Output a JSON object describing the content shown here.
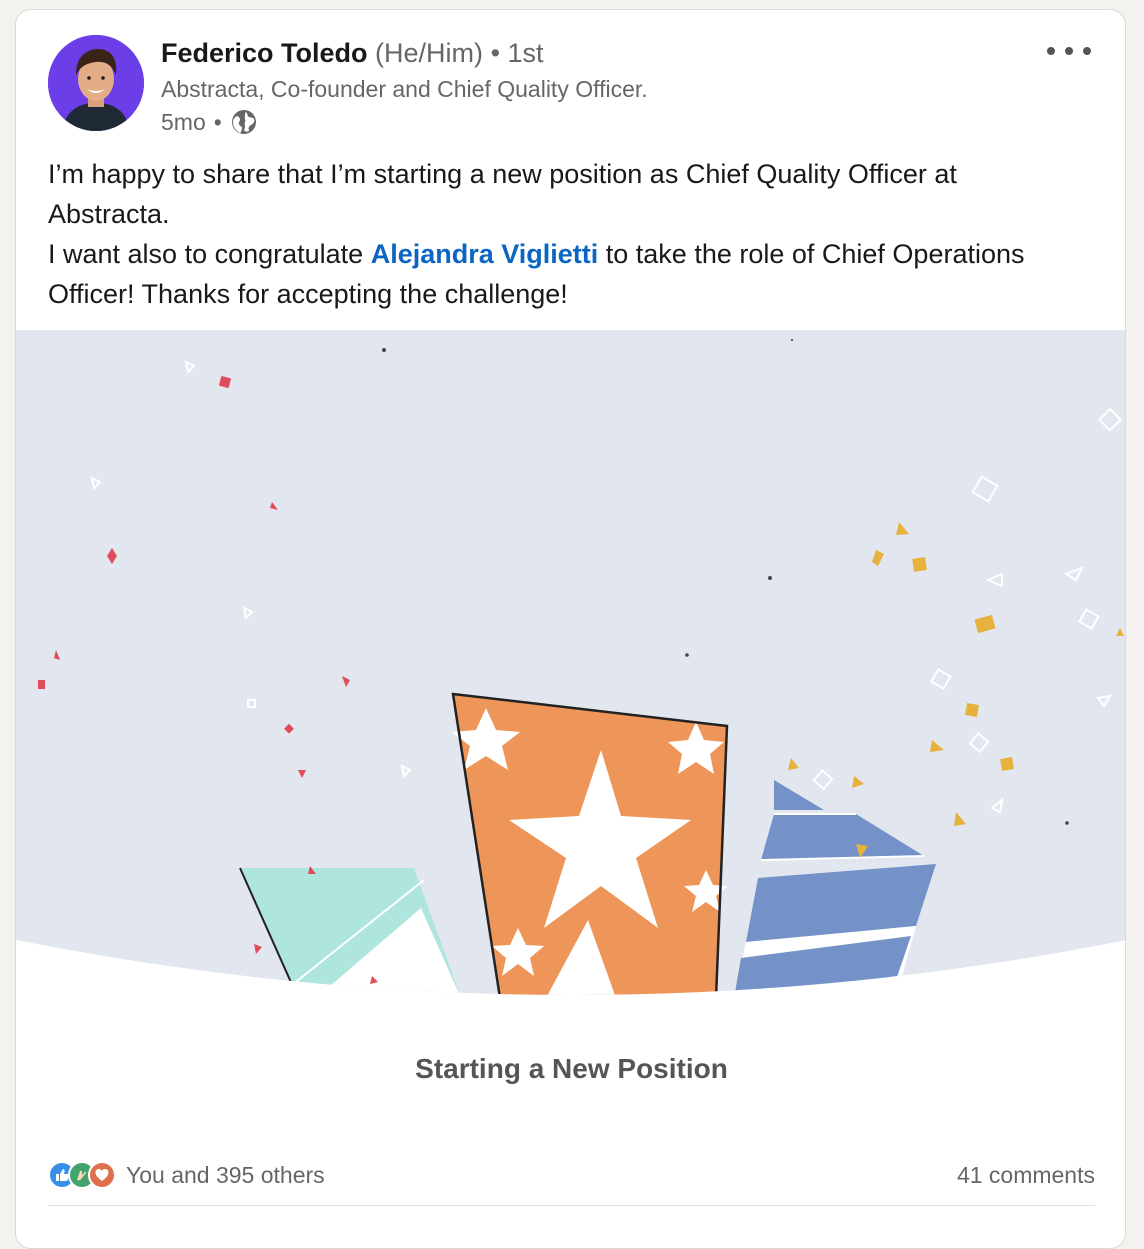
{
  "post": {
    "author_name": "Federico Toledo",
    "pronouns": "(He/Him)",
    "degree": "• 1st",
    "headline": "Abstracta, Co-founder and Chief Quality Officer.",
    "time": "5mo",
    "visibility_icon": "globe-icon",
    "text_line1": "I’m happy to share that I’m starting a new position as Chief Quality Officer at Abstracta.",
    "text_line2_before": "I want also to congratulate ",
    "mention": "Alejandra Viglietti",
    "text_line2_after": " to take the role of Chief Operations Officer! Thanks for accepting the challenge!"
  },
  "banner": {
    "caption": "Starting a New Position",
    "colors": {
      "background": "#e2e6ee",
      "orange": "#ee965a",
      "teal": "#aee6de",
      "blue": "#7592c8",
      "confetti_red": "#e04b5a",
      "confetti_gold": "#e6b13c"
    }
  },
  "social": {
    "reaction_icons": [
      "like-icon",
      "celebrate-icon",
      "love-icon"
    ],
    "reactions_text": "You and 395 others",
    "comments_text": "41 comments"
  }
}
